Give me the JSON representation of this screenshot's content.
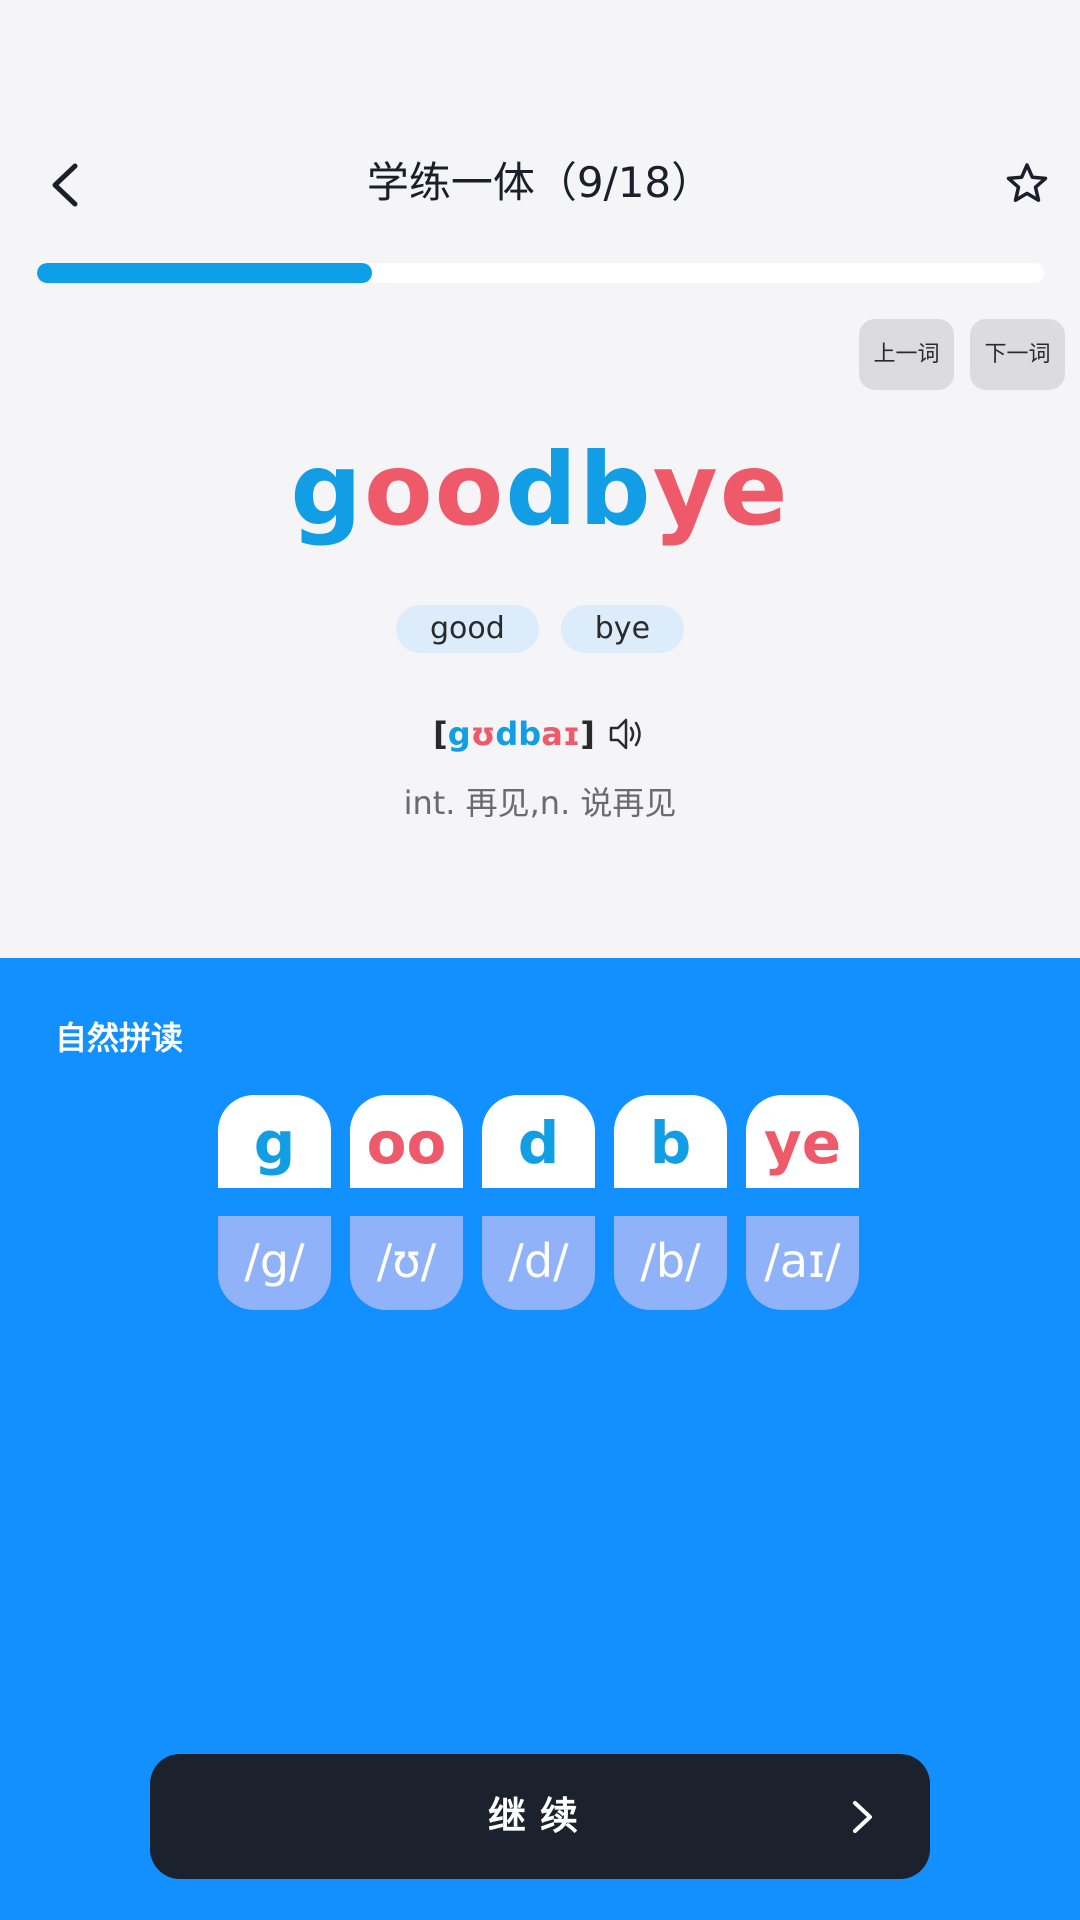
{
  "header": {
    "title": "学练一体（9/18）"
  },
  "progress": {
    "fraction": 0.333
  },
  "nav": {
    "prev_label": "上一词",
    "next_label": "下一词"
  },
  "word": {
    "segments": [
      {
        "text": "g",
        "color": "#119ee5"
      },
      {
        "text": "oo",
        "color": "#ef5a6a"
      },
      {
        "text": "d",
        "color": "#119ee5"
      },
      {
        "text": "b",
        "color": "#119ee5"
      },
      {
        "text": "ye",
        "color": "#ef5a6a"
      }
    ]
  },
  "syllables": [
    "good",
    "bye"
  ],
  "phonetic": {
    "open_bracket": "[",
    "segments": [
      {
        "text": "g",
        "color": "#119ee5"
      },
      {
        "text": "ʊ",
        "color": "#ef5a6a"
      },
      {
        "text": "d",
        "color": "#119ee5"
      },
      {
        "text": "b",
        "color": "#119ee5"
      },
      {
        "text": "aɪ",
        "color": "#ef5a6a"
      }
    ],
    "close_bracket": "]"
  },
  "meaning": "int. 再见,n. 说再见",
  "phonics": {
    "title": "自然拼读",
    "tiles": [
      {
        "letters": "g",
        "sound": "/g/",
        "color": "#119ee5"
      },
      {
        "letters": "oo",
        "sound": "/ʊ/",
        "color": "#ef5a6a"
      },
      {
        "letters": "d",
        "sound": "/d/",
        "color": "#119ee5"
      },
      {
        "letters": "b",
        "sound": "/b/",
        "color": "#119ee5"
      },
      {
        "letters": "ye",
        "sound": "/aɪ/",
        "color": "#ef5a6a"
      }
    ]
  },
  "continue_button": {
    "label": "继续"
  },
  "icons": {
    "back": "chevron-left-icon",
    "favorite": "star-icon",
    "audio": "speaker-icon",
    "continue": "chevron-right-icon"
  },
  "colors": {
    "accent_blue": "#119ee5",
    "accent_red": "#ef5a6a",
    "panel_blue": "#1390ff",
    "button_dark": "#1c212e"
  }
}
